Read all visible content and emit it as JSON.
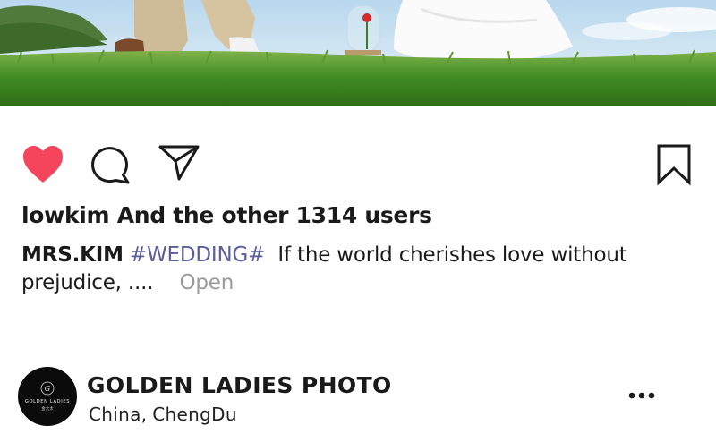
{
  "post": {
    "likes_text": "lowkim And the other 1314 users",
    "caption": {
      "author": "MRS.KIM",
      "hashtag": "#WEDDING#",
      "text_line1": "If the world cherishes love without",
      "text_line2": "prejudice, ....",
      "more_label": "Open"
    }
  },
  "actions": {
    "like_icon": "heart-icon",
    "comment_icon": "comment-icon",
    "share_icon": "send-icon",
    "save_icon": "bookmark-icon",
    "like_color": "#f5455c"
  },
  "profile": {
    "name": "GOLDEN LADIES PHOTO",
    "city": "China,",
    "district": "ChengDu",
    "avatar_logo_text": "GOLDEN LADIES",
    "avatar_sub_text": "金太太",
    "menu_icon": "more-horizontal-icon"
  }
}
